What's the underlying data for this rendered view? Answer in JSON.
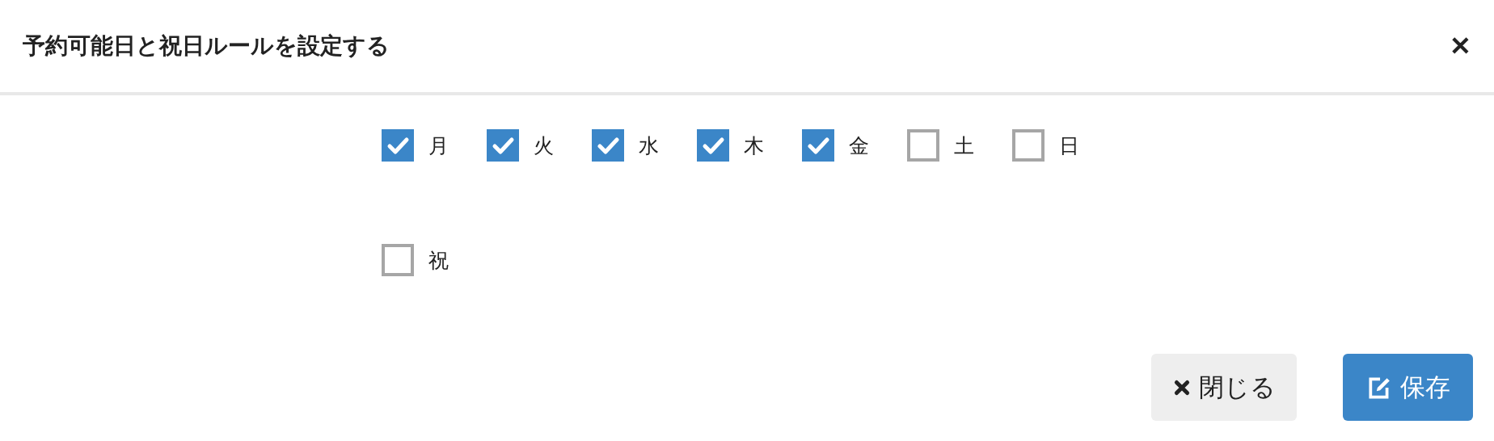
{
  "dialog": {
    "title": "予約可能日と祝日ルールを設定する",
    "close_icon": "✕"
  },
  "days": [
    {
      "label": "月",
      "checked": true
    },
    {
      "label": "火",
      "checked": true
    },
    {
      "label": "水",
      "checked": true
    },
    {
      "label": "木",
      "checked": true
    },
    {
      "label": "金",
      "checked": true
    },
    {
      "label": "土",
      "checked": false
    },
    {
      "label": "日",
      "checked": false
    }
  ],
  "holiday": {
    "label": "祝",
    "checked": false
  },
  "buttons": [
    {
      "kind": "close",
      "label": "閉じる"
    },
    {
      "kind": "save",
      "label": "保存"
    }
  ]
}
